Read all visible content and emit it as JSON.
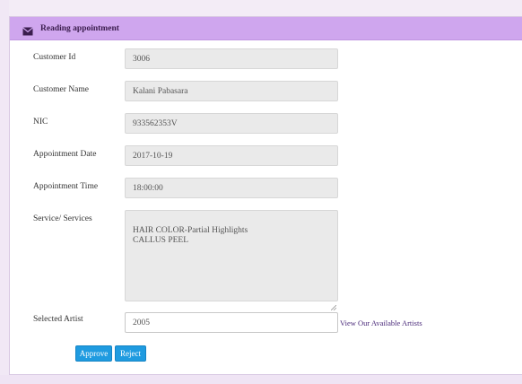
{
  "header": {
    "title": "Reading appointment",
    "icon": "envelope-icon"
  },
  "form": {
    "customer_id": {
      "label": "Customer Id",
      "value": "3006"
    },
    "customer_name": {
      "label": "Customer Name",
      "value": "Kalani Pabasara"
    },
    "nic": {
      "label": "NIC",
      "value": "933562353V"
    },
    "appointment_date": {
      "label": "Appointment Date",
      "value": "2017-10-19"
    },
    "appointment_time": {
      "label": "Appointment Time",
      "value": "18:00:00"
    },
    "services": {
      "label": "Service/ Services",
      "value": "HAIR COLOR-Partial Highlights\nCALLUS PEEL"
    },
    "selected_artist": {
      "label": "Selected Artist",
      "value": "2005"
    }
  },
  "links": {
    "view_artists": "View Our Available Artists"
  },
  "buttons": {
    "approve": "Approve",
    "reject": "Reject"
  },
  "colors": {
    "header_bg": "#cfa6ee",
    "button_bg": "#1f9be0",
    "link": "#4a2a7a"
  }
}
